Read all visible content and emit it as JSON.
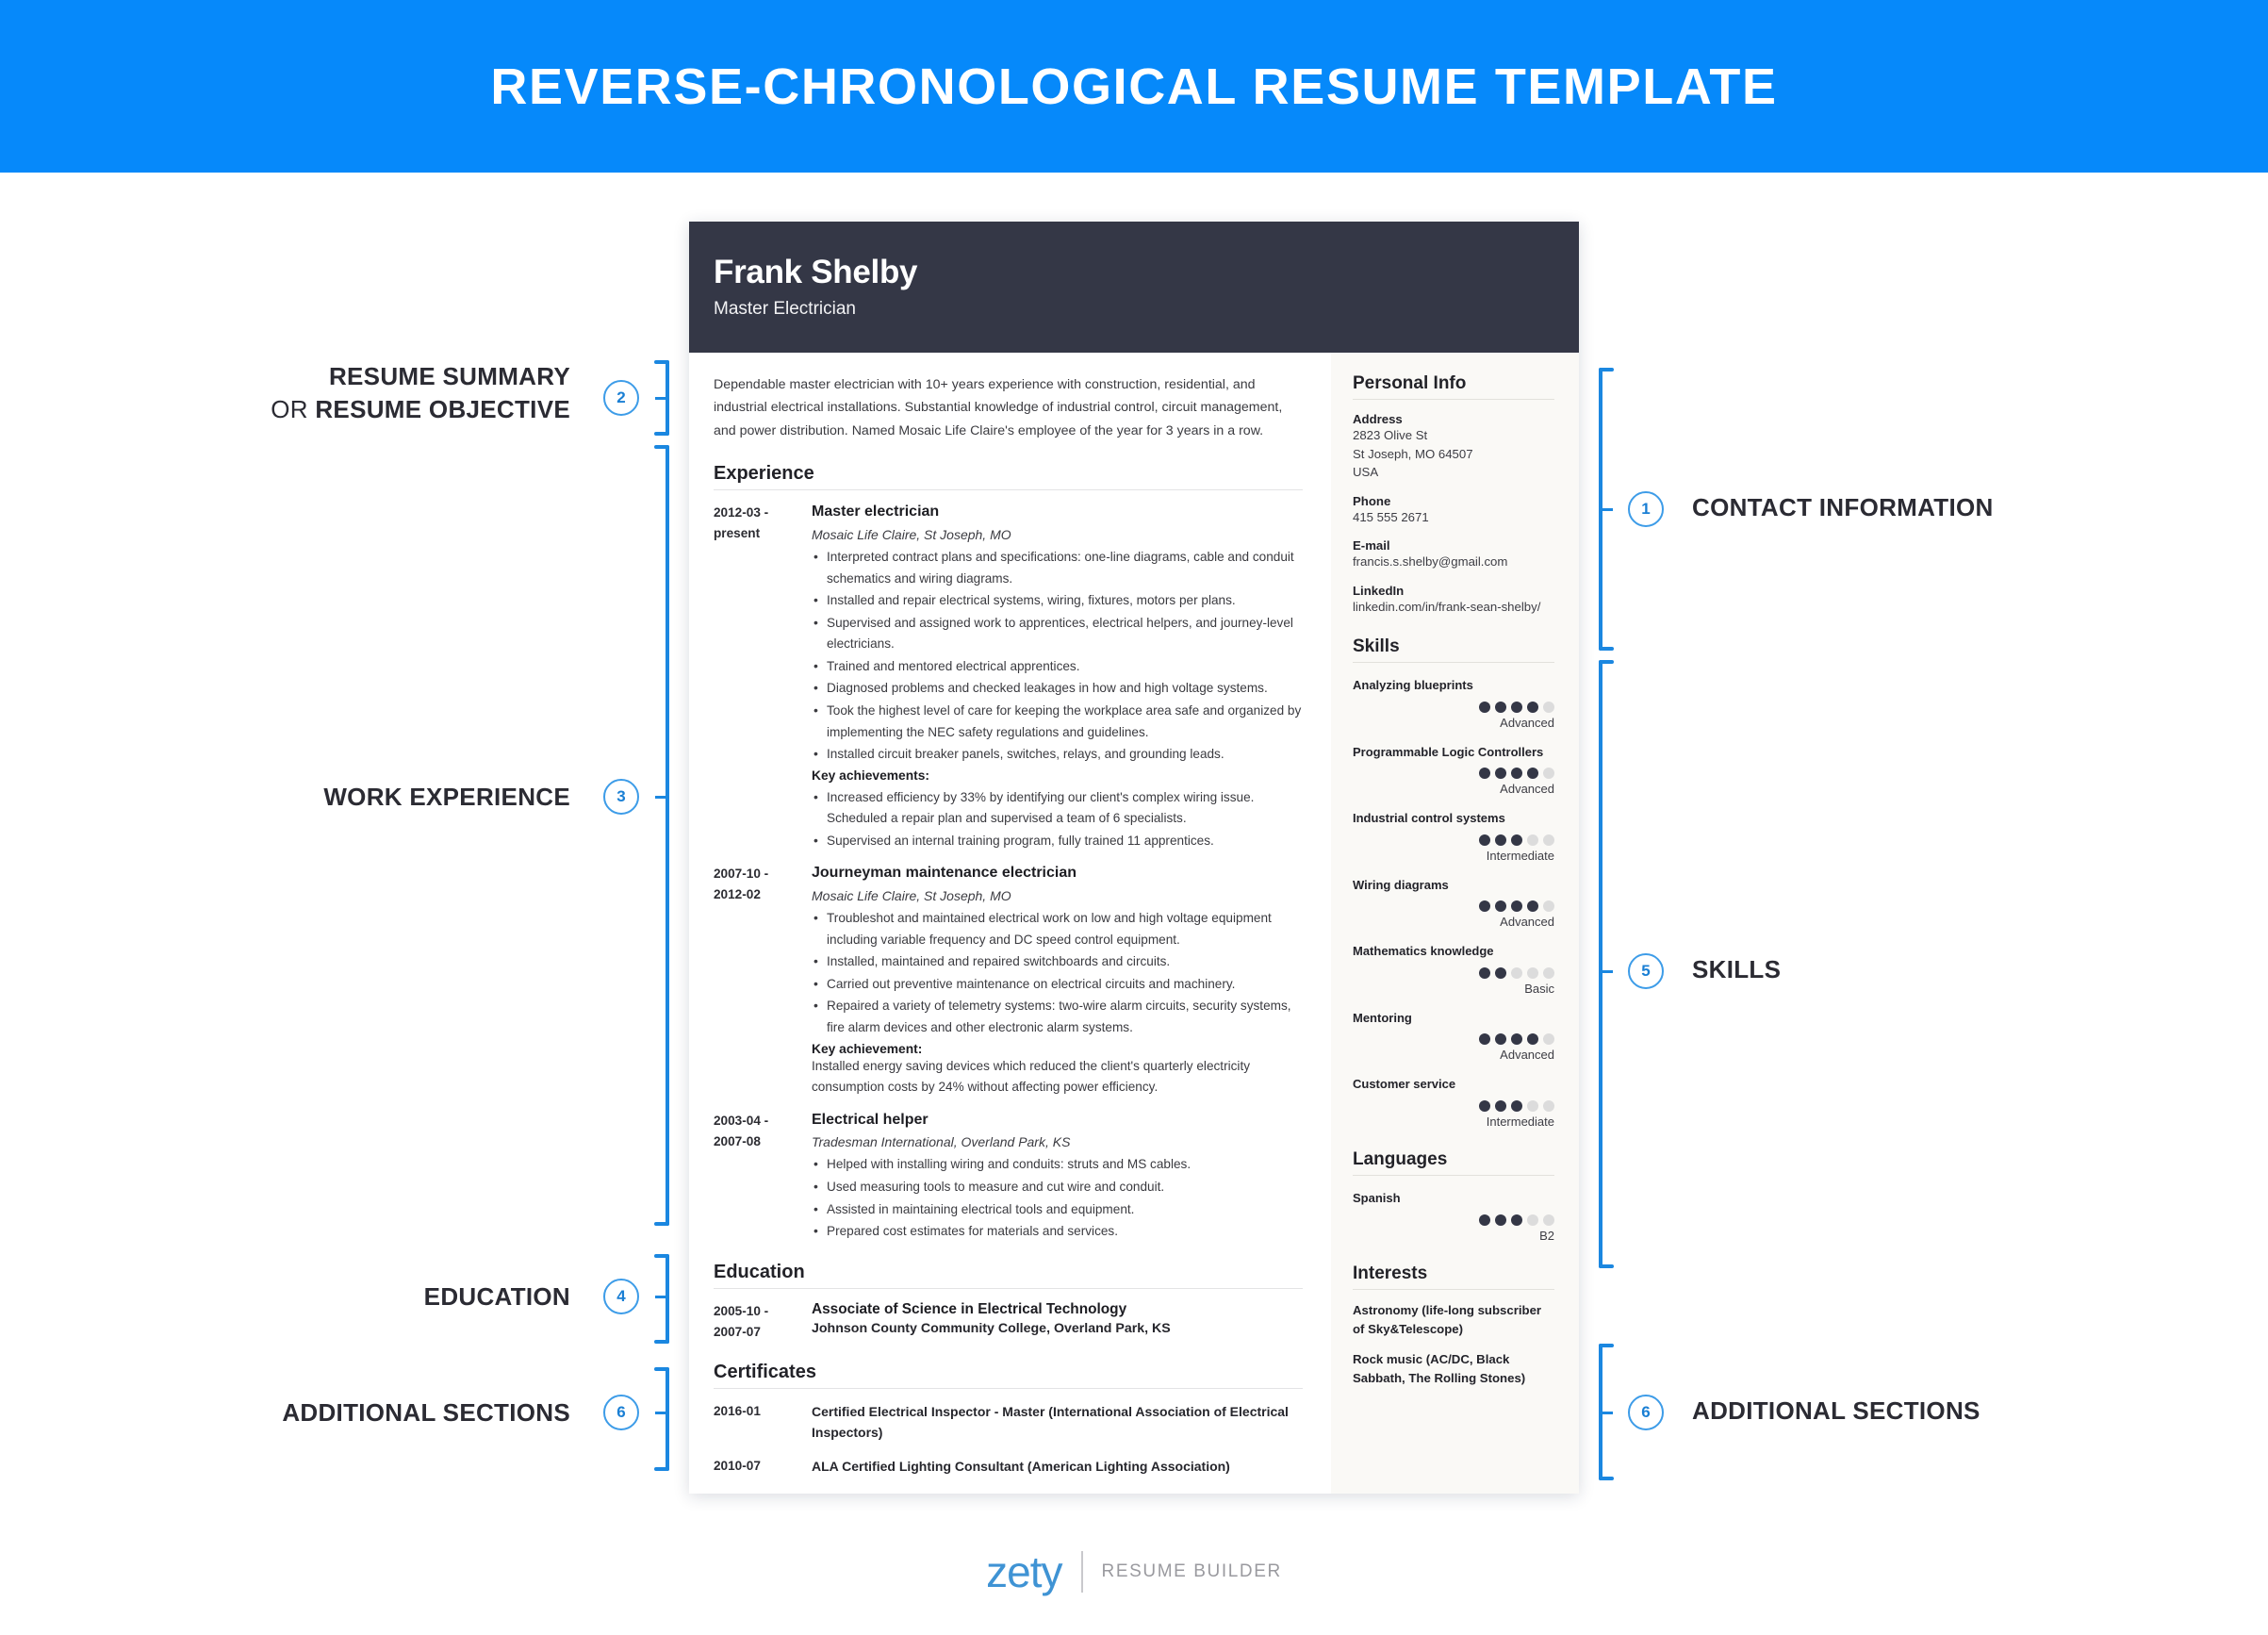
{
  "colors": {
    "accent": "#0689fa",
    "dark": "#343746",
    "bracket": "#1b87e0",
    "sidebar_bg": "#faf9f6"
  },
  "banner": {
    "title": "REVERSE-CHRONOLOGICAL RESUME TEMPLATE"
  },
  "resume": {
    "name": "Frank Shelby",
    "job_title": "Master Electrician",
    "summary": "Dependable master electrician with 10+ years experience with construction, residential, and industrial electrical installations. Substantial knowledge of industrial control, circuit management, and power distribution. Named Mosaic Life Claire's employee of the year for 3 years in a row.",
    "sections": {
      "experience_heading": "Experience",
      "education_heading": "Education",
      "certificates_heading": "Certificates"
    },
    "experience": [
      {
        "date": "2012-03 - present",
        "role": "Master electrician",
        "org": "Mosaic Life Claire, St Joseph, MO",
        "bullets": [
          "Interpreted contract plans and specifications: one-line diagrams, cable and conduit schematics and wiring diagrams.",
          "Installed and repair electrical systems, wiring, fixtures, motors per plans.",
          "Supervised and assigned work to apprentices, electrical helpers, and journey-level electricians.",
          "Trained and mentored electrical apprentices.",
          "Diagnosed problems and checked leakages in how and high voltage systems.",
          "Took the highest level of care for keeping the workplace area safe and organized by implementing the NEC safety regulations and guidelines.",
          "Installed circuit breaker panels, switches, relays, and grounding leads."
        ],
        "key_heading": "Key achievements:",
        "key_bullets": [
          "Increased efficiency by 33% by identifying our client's complex wiring issue. Scheduled a repair plan and supervised a team of 6 specialists.",
          "Supervised an internal training program, fully trained 11 apprentices."
        ],
        "key_paragraph": ""
      },
      {
        "date": "2007-10 - 2012-02",
        "role": "Journeyman maintenance electrician",
        "org": "Mosaic Life Claire, St Joseph, MO",
        "bullets": [
          "Troubleshot and maintained electrical work on low and high voltage equipment including variable frequency and DC speed control equipment.",
          "Installed, maintained and repaired switchboards and circuits.",
          "Carried out preventive maintenance on electrical circuits and machinery.",
          "Repaired a variety of telemetry systems: two-wire alarm circuits, security systems, fire alarm devices and other electronic alarm systems."
        ],
        "key_heading": "Key achievement:",
        "key_bullets": [],
        "key_paragraph": "Installed energy saving devices which reduced the client's quarterly electricity consumption costs by 24% without affecting power efficiency."
      },
      {
        "date": "2003-04 - 2007-08",
        "role": "Electrical helper",
        "org": "Tradesman International, Overland Park, KS",
        "bullets": [
          "Helped with installing wiring and conduits: struts and MS cables.",
          "Used measuring tools to measure and cut wire and conduit.",
          "Assisted in maintaining electrical tools and equipment.",
          "Prepared cost estimates for materials and services."
        ],
        "key_heading": "",
        "key_bullets": [],
        "key_paragraph": ""
      }
    ],
    "education": [
      {
        "date": "2005-10 - 2007-07",
        "degree": "Associate of Science in Electrical Technology",
        "school": "Johnson County Community College, Overland Park, KS"
      }
    ],
    "certificates": [
      {
        "date": "2016-01",
        "text": "Certified Electrical Inspector - Master (International Association of Electrical Inspectors)"
      },
      {
        "date": "2010-07",
        "text": "ALA Certified Lighting Consultant (American Lighting Association)"
      }
    ],
    "sidebar": {
      "personal_info_heading": "Personal Info",
      "address_label": "Address",
      "address_lines": [
        "2823 Olive St",
        "St Joseph, MO 64507",
        "USA"
      ],
      "phone_label": "Phone",
      "phone": "415 555 2671",
      "email_label": "E-mail",
      "email": "francis.s.shelby@gmail.com",
      "linkedin_label": "LinkedIn",
      "linkedin": "linkedin.com/in/frank-sean-shelby/",
      "skills_heading": "Skills",
      "skills": [
        {
          "name": "Analyzing blueprints",
          "filled": 4,
          "total": 5,
          "level": "Advanced"
        },
        {
          "name": "Programmable Logic Controllers",
          "filled": 4,
          "total": 5,
          "level": "Advanced"
        },
        {
          "name": "Industrial control systems",
          "filled": 3,
          "total": 5,
          "level": "Intermediate"
        },
        {
          "name": "Wiring diagrams",
          "filled": 4,
          "total": 5,
          "level": "Advanced"
        },
        {
          "name": "Mathematics knowledge",
          "filled": 2,
          "total": 5,
          "level": "Basic"
        },
        {
          "name": "Mentoring",
          "filled": 4,
          "total": 5,
          "level": "Advanced"
        },
        {
          "name": "Customer service",
          "filled": 3,
          "total": 5,
          "level": "Intermediate"
        }
      ],
      "languages_heading": "Languages",
      "languages": [
        {
          "name": "Spanish",
          "filled": 3,
          "total": 5,
          "level": "B2"
        }
      ],
      "interests_heading": "Interests",
      "interests": [
        "Astronomy (life-long subscriber of Sky&Telescope)",
        "Rock music (AC/DC, Black Sabbath, The Rolling Stones)"
      ]
    }
  },
  "annotations": {
    "left": [
      {
        "number": "2",
        "line1": "RESUME SUMMARY",
        "line2_thin": "OR ",
        "line2_bold": "RESUME OBJECTIVE"
      },
      {
        "number": "3",
        "line1": "WORK EXPERIENCE",
        "line2_thin": "",
        "line2_bold": ""
      },
      {
        "number": "4",
        "line1": "EDUCATION",
        "line2_thin": "",
        "line2_bold": ""
      },
      {
        "number": "6",
        "line1": "ADDITIONAL SECTIONS",
        "line2_thin": "",
        "line2_bold": ""
      }
    ],
    "right": [
      {
        "number": "1",
        "label": "CONTACT INFORMATION"
      },
      {
        "number": "5",
        "label": "SKILLS"
      },
      {
        "number": "6",
        "label": "ADDITIONAL SECTIONS"
      }
    ]
  },
  "footer": {
    "brand": "zety",
    "tagline": "RESUME BUILDER"
  }
}
